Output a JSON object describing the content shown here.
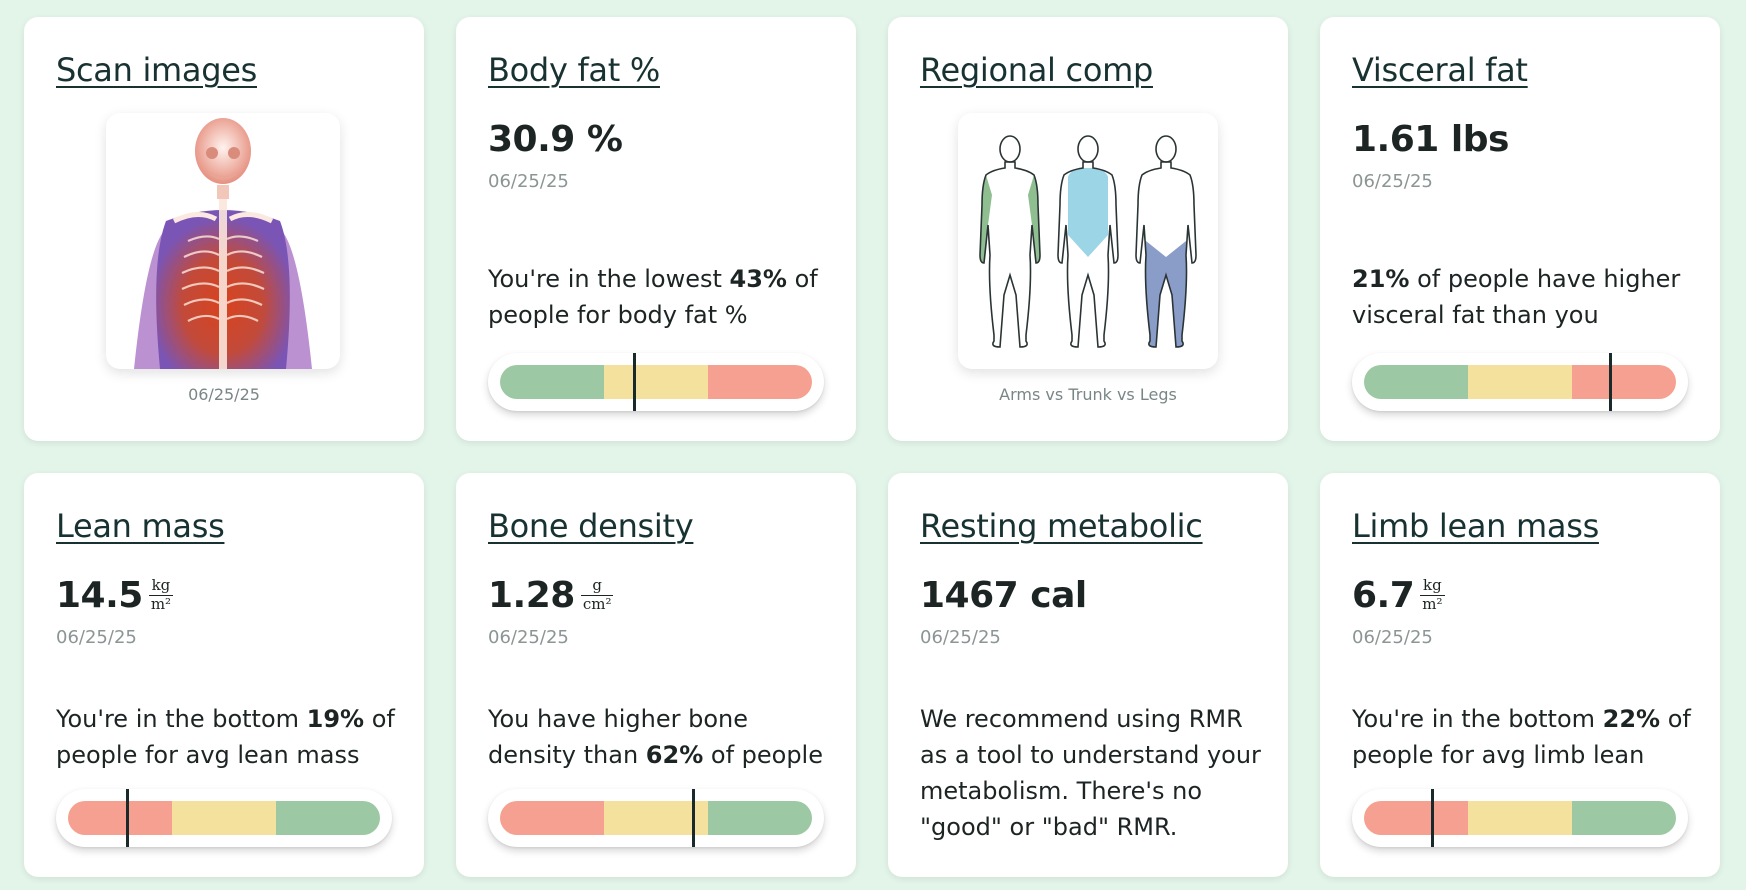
{
  "colors": {
    "background": "#e3f4e9",
    "good": "#9dc8a4",
    "medium": "#f5e19e",
    "bad": "#f5a091",
    "arms_highlight": "#8fbf91",
    "trunk_highlight": "#9cd5e6",
    "legs_highlight": "#8a9dc9"
  },
  "cards": {
    "scan": {
      "title": "Scan images",
      "date": "06/25/25"
    },
    "bodyfat": {
      "title": "Body fat %",
      "value": "30.9 %",
      "date": "06/25/25",
      "desc_pre": "You're in the lowest ",
      "desc_bold": "43%",
      "desc_post": " of people for body fat %",
      "gauge": {
        "segments": [
          "good",
          "medium",
          "bad"
        ],
        "marker_fraction": 0.43
      }
    },
    "regional": {
      "title": "Regional comp",
      "caption": "Arms vs Trunk vs Legs"
    },
    "visceral": {
      "title": "Visceral fat",
      "value": "1.61 lbs",
      "date": "06/25/25",
      "desc_bold": "21%",
      "desc_post": " of people have higher visceral fat than you",
      "gauge": {
        "segments": [
          "good",
          "medium",
          "bad"
        ],
        "marker_fraction": 0.79
      }
    },
    "lean": {
      "title": "Lean mass",
      "value": "14.5",
      "unit_num": "kg",
      "unit_den": "m²",
      "date": "06/25/25",
      "desc_pre": "You're in the bottom ",
      "desc_bold": "19%",
      "desc_post": " of people for avg lean mass",
      "gauge": {
        "segments": [
          "bad",
          "medium",
          "good"
        ],
        "marker_fraction": 0.19
      }
    },
    "bone": {
      "title": "Bone density",
      "value": "1.28",
      "unit_num": "g",
      "unit_den": "cm²",
      "date": "06/25/25",
      "desc_pre": "You have higher bone density than ",
      "desc_bold": "62%",
      "desc_post": " of people",
      "gauge": {
        "segments": [
          "bad",
          "medium",
          "good"
        ],
        "marker_fraction": 0.62
      }
    },
    "rmr": {
      "title": "Resting metabolic",
      "value": "1467 cal",
      "date": "06/25/25",
      "desc": "We recommend using RMR as a tool to understand your metabolism. There's no \"good\" or \"bad\" RMR."
    },
    "limb": {
      "title": "Limb lean mass",
      "value": "6.7",
      "unit_num": "kg",
      "unit_den": "m²",
      "date": "06/25/25",
      "desc_pre": "You're in the bottom ",
      "desc_bold": "22%",
      "desc_post": " of people for avg limb lean",
      "gauge": {
        "segments": [
          "bad",
          "medium",
          "good"
        ],
        "marker_fraction": 0.22
      }
    }
  }
}
